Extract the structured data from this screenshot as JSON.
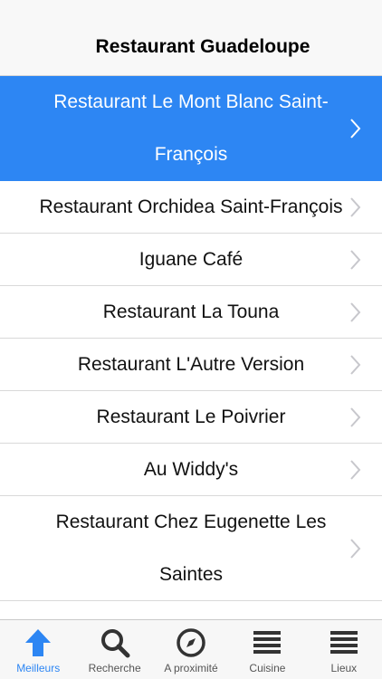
{
  "nav": {
    "title": "Restaurant Guadeloupe"
  },
  "list": {
    "items": [
      {
        "label": "Restaurant Le Mont Blanc Saint-François",
        "selected": true
      },
      {
        "label": "Restaurant Orchidea Saint-François"
      },
      {
        "label": "Iguane Café"
      },
      {
        "label": "Restaurant La Touna"
      },
      {
        "label": "Restaurant L'Autre Version"
      },
      {
        "label": "Restaurant Le Poivrier"
      },
      {
        "label": "Au Widdy's"
      },
      {
        "label": "Restaurant Chez Eugenette Les Saintes"
      }
    ]
  },
  "tabs": [
    {
      "label": "Meilleurs",
      "icon": "arrow-up-icon",
      "active": true
    },
    {
      "label": "Recherche",
      "icon": "search-icon"
    },
    {
      "label": "A proximité",
      "icon": "compass-icon"
    },
    {
      "label": "Cuisine",
      "icon": "list-icon"
    },
    {
      "label": "Lieux",
      "icon": "list-icon"
    }
  ],
  "colors": {
    "accent": "#2d86f3",
    "selected_text": "#ffffff",
    "separator": "#d9d9d9"
  }
}
